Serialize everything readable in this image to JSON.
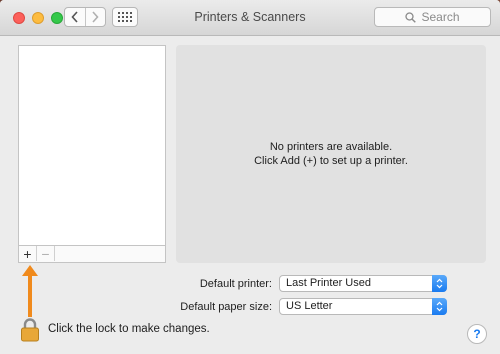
{
  "window": {
    "title": "Printers & Scanners",
    "search_placeholder": "Search"
  },
  "printer_list": {
    "add_button": "+",
    "remove_button": "−"
  },
  "detail": {
    "line1": "No printers are available.",
    "line2": "Click Add (+) to set up a printer."
  },
  "settings": {
    "default_printer_label": "Default printer:",
    "default_printer_value": "Last Printer Used",
    "default_paper_label": "Default paper size:",
    "default_paper_value": "US Letter"
  },
  "footer": {
    "lock_text": "Click the lock to make changes.",
    "help_label": "?"
  },
  "annotation": {
    "arrow_color": "#f08a1c"
  }
}
